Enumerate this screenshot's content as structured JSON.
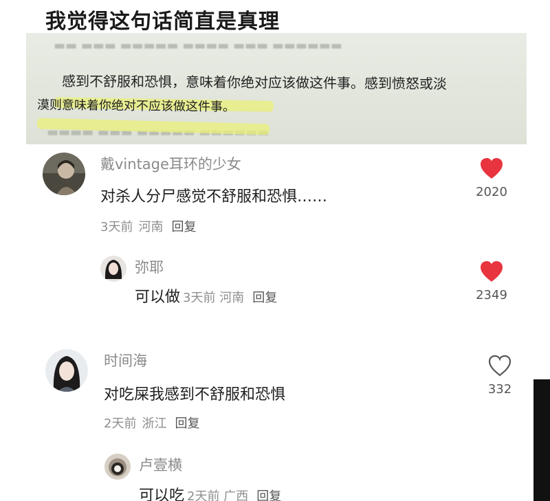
{
  "title": "我觉得这句话简直是真理",
  "book_photo": {
    "line1": "感到不舒服和恐惧，意味着你绝对应该做这件事。感到愤怒或淡",
    "line2": "漠则意味着你绝对不应该做这件事。"
  },
  "colors": {
    "like_red": "#e8343f",
    "username_gray": "#8a8a8a",
    "highlight": "#eef07a"
  },
  "comments": [
    {
      "username": "戴vintage耳环的少女",
      "content": "对杀人分尸感觉不舒服和恐惧……",
      "time": "3天前",
      "location": "河南",
      "reply": "回复",
      "likes": "2020",
      "liked": true,
      "reply_item": {
        "username": "弥耶",
        "content": "可以做",
        "time": "3天前",
        "location": "河南",
        "reply": "回复",
        "likes": "2349",
        "liked": true
      }
    },
    {
      "username": "时间海",
      "content": "对吃屎我感到不舒服和恐惧",
      "time": "2天前",
      "location": "浙江",
      "reply": "回复",
      "likes": "332",
      "liked": false,
      "reply_item": {
        "username": "卢壹横",
        "content": "可以吃",
        "time": "2天前",
        "location": "广西",
        "reply": "回复"
      }
    }
  ]
}
